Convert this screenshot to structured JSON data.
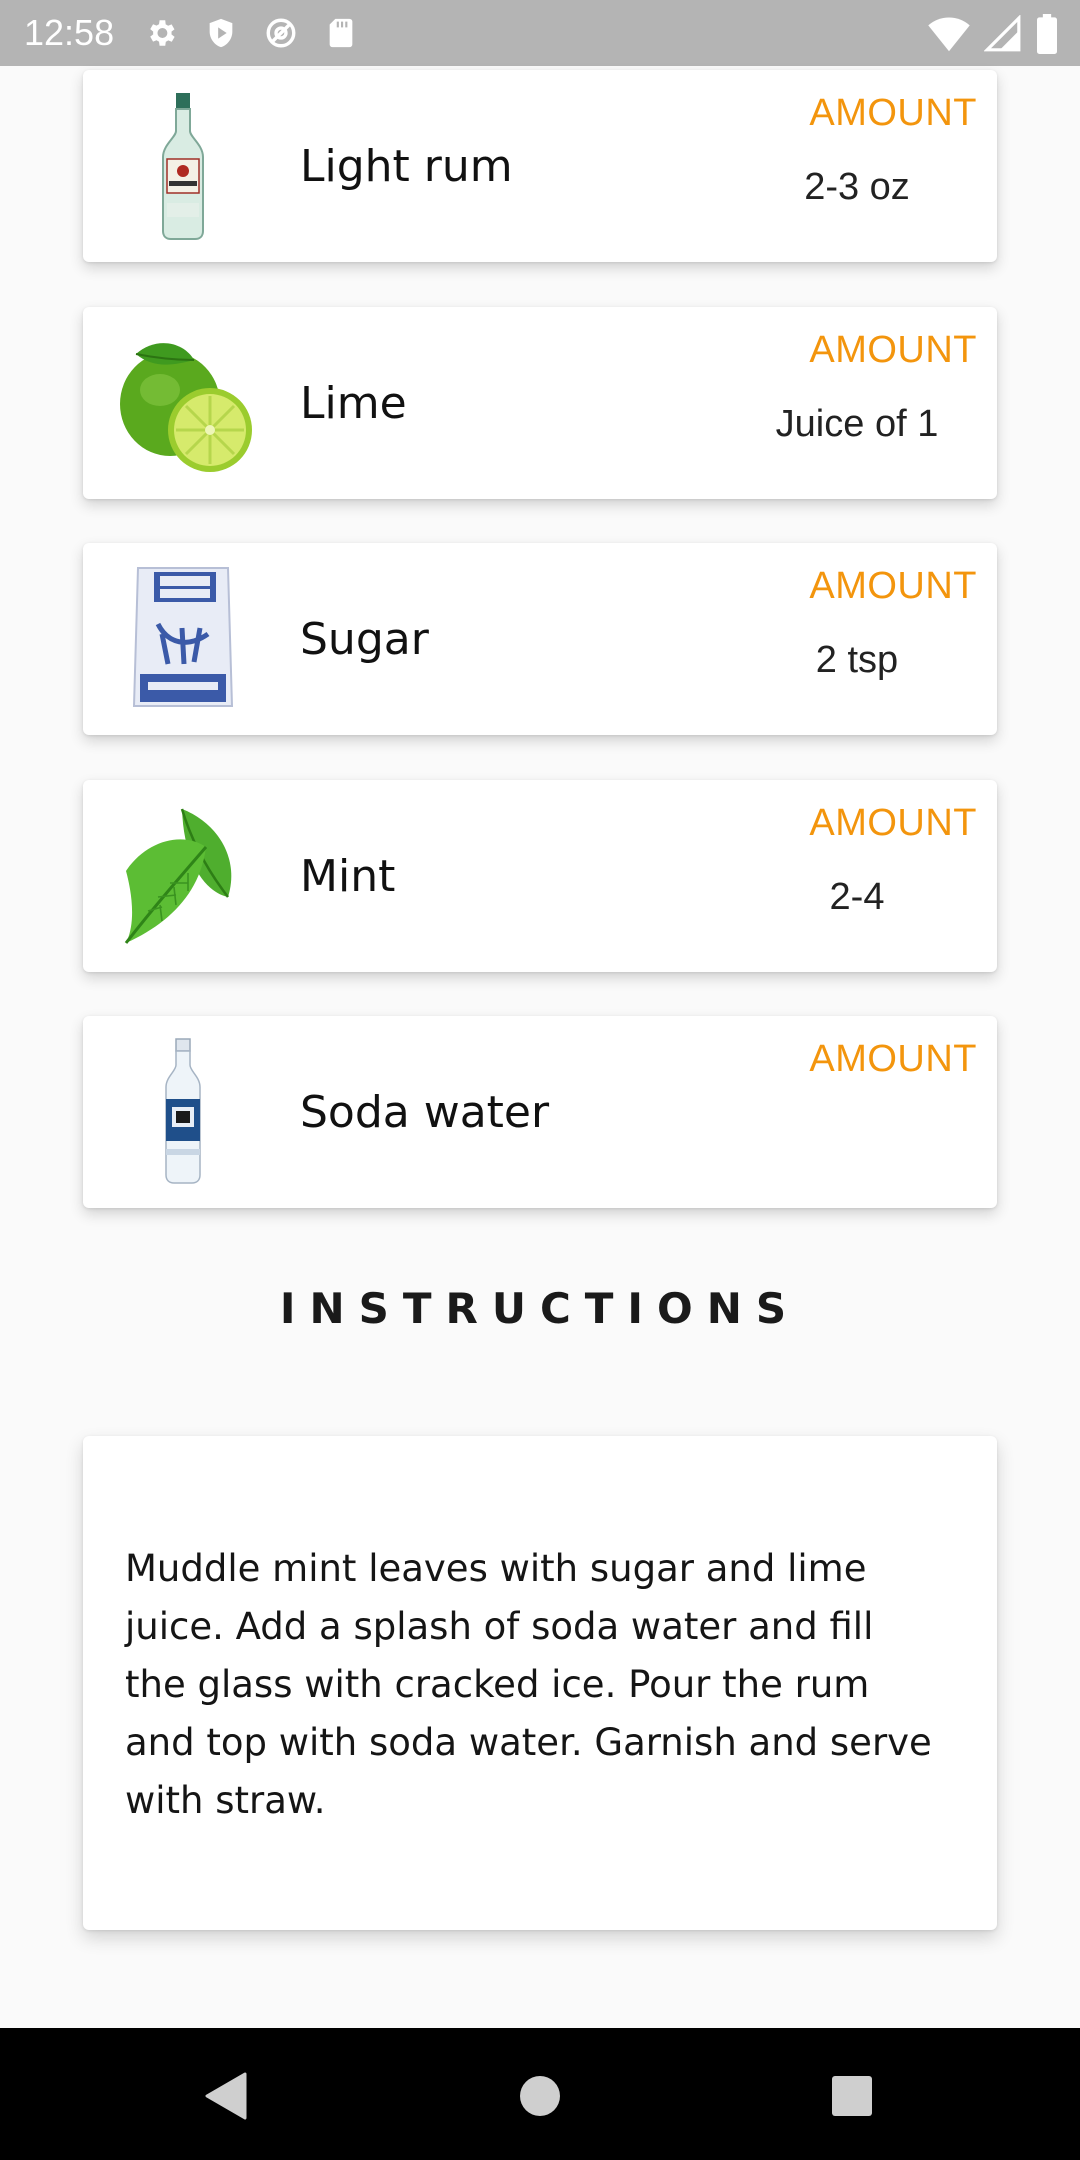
{
  "status_bar": {
    "time": "12:58",
    "icons_left": [
      "gear-icon",
      "shield-play-icon",
      "at-sign-icon",
      "sd-card-icon"
    ],
    "icons_right": [
      "wifi-icon",
      "signal-icon",
      "battery-icon"
    ]
  },
  "ingredients": [
    {
      "name": "Light rum",
      "amount_label": "AMOUNT",
      "amount": "2-3 oz",
      "image": "rum-bottle-image"
    },
    {
      "name": "Lime",
      "amount_label": "AMOUNT",
      "amount": "Juice of 1",
      "image": "lime-image"
    },
    {
      "name": "Sugar",
      "amount_label": "AMOUNT",
      "amount": "2 tsp",
      "image": "sugar-bag-image"
    },
    {
      "name": "Mint",
      "amount_label": "AMOUNT",
      "amount": "2-4",
      "image": "mint-leaves-image"
    },
    {
      "name": "Soda water",
      "amount_label": "AMOUNT",
      "amount": "",
      "image": "soda-bottle-image"
    }
  ],
  "instructions": {
    "title": "INSTRUCTIONS",
    "text": "Muddle mint leaves with sugar and lime juice. Add a splash of soda water and fill the glass with cracked ice. Pour the rum and top with soda water. Garnish and serve with straw."
  },
  "nav_bar": {
    "buttons": [
      "back-icon",
      "home-icon",
      "recents-icon"
    ]
  },
  "colors": {
    "accent": "#f3950d",
    "background": "#fafafa",
    "status_bar": "#b4b4b4"
  }
}
